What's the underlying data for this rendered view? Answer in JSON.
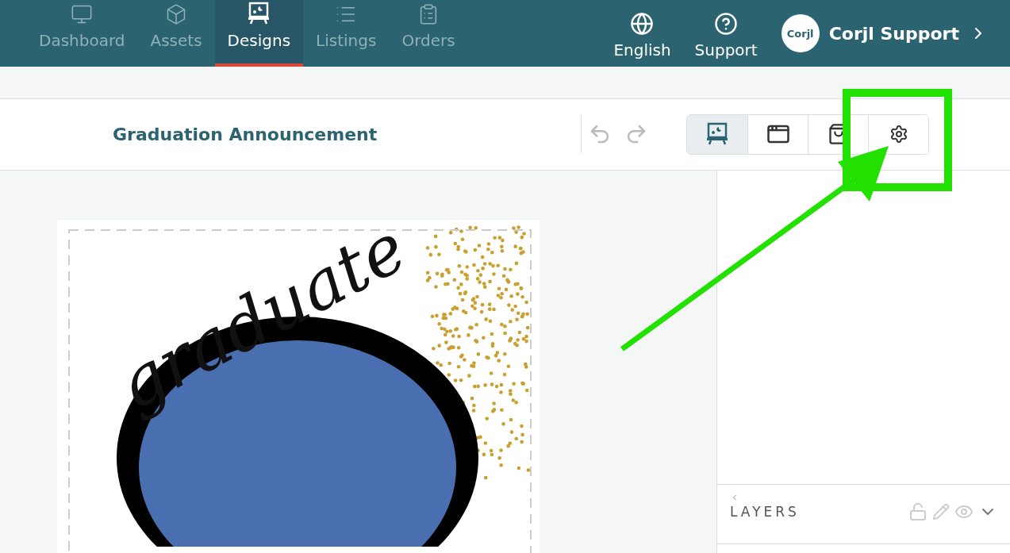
{
  "nav": {
    "tabs": [
      {
        "label": "Dashboard",
        "selected": false
      },
      {
        "label": "Assets",
        "selected": false
      },
      {
        "label": "Designs",
        "selected": true
      },
      {
        "label": "Listings",
        "selected": false
      },
      {
        "label": "Orders",
        "selected": false
      }
    ],
    "actions": [
      {
        "label": "English"
      },
      {
        "label": "Support"
      }
    ],
    "account": {
      "logo": "Corjl",
      "name": "Corjl Support"
    }
  },
  "toolbar": {
    "title": "Graduation Announcement",
    "modes": [
      {
        "selected": true
      },
      {
        "selected": false
      },
      {
        "selected": false
      },
      {
        "selected": false
      }
    ]
  },
  "design": {
    "script_text": "graduate"
  },
  "layers": {
    "title": "LAYERS"
  }
}
